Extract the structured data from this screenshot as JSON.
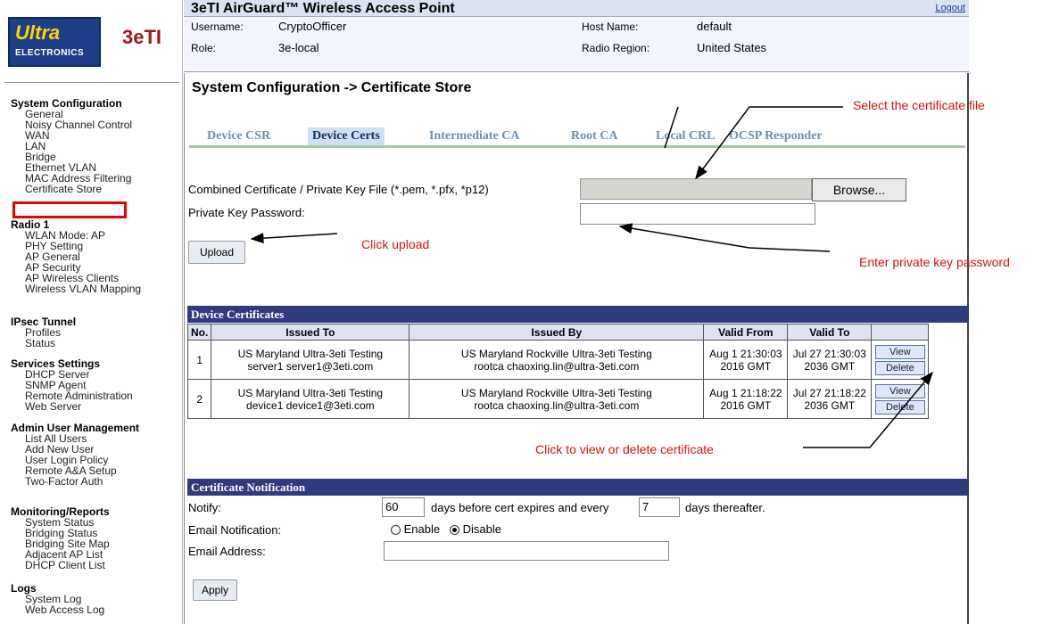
{
  "brand": {
    "ultra_line1": "Ultra",
    "ultra_line2": "ELECTRONICS",
    "company": "3eTI"
  },
  "header": {
    "title": "3eTI AirGuard™ Wireless Access Point",
    "logout": "Logout",
    "username_label": "Username:",
    "username": "CryptoOfficer",
    "role_label": "Role:",
    "role": "3e-local",
    "hostname_label": "Host Name:",
    "hostname": "default",
    "region_label": "Radio Region:",
    "region": "United States"
  },
  "sidebar": {
    "sections": [
      {
        "title": "System Configuration",
        "items": [
          "General",
          "Noisy Channel Control",
          "WAN",
          "LAN",
          "Bridge",
          "Ethernet VLAN",
          "MAC Address Filtering",
          "Certificate Store"
        ]
      },
      {
        "title": "Radio 1",
        "items": [
          "WLAN Mode: AP",
          "PHY Setting",
          "AP General",
          "AP Security",
          "AP Wireless Clients",
          "Wireless VLAN Mapping"
        ]
      },
      {
        "title": "IPsec Tunnel",
        "items": [
          "Profiles",
          "Status"
        ]
      },
      {
        "title": "Services Settings",
        "items": [
          "DHCP Server",
          "SNMP Agent",
          "Remote Administration",
          "Web Server"
        ]
      },
      {
        "title": "Admin User Management",
        "items": [
          "List All Users",
          "Add New User",
          "User Login Policy",
          "Remote A&A Setup",
          "Two-Factor Auth"
        ]
      },
      {
        "title": "Monitoring/Reports",
        "items": [
          "System Status",
          "Bridging Status",
          "Bridging Site Map",
          "Adjacent AP List",
          "DHCP Client List"
        ]
      },
      {
        "title": "Logs",
        "items": [
          "System Log",
          "Web Access Log"
        ]
      }
    ]
  },
  "page": {
    "title": "System Configuration -> Certificate Store"
  },
  "tabs": [
    "Device CSR",
    "Device Certs",
    "Intermediate CA",
    "Root CA",
    "Local CRL",
    "OCSP Responder"
  ],
  "upload_form": {
    "file_label": "Combined Certificate / Private Key File (*.pem, *.pfx, *p12)",
    "browse": "Browse...",
    "password_label": "Private Key Password:",
    "upload": "Upload"
  },
  "certificates": {
    "header": "Device Certificates",
    "columns": [
      "No.",
      "Issued To",
      "Issued By",
      "Valid From",
      "Valid To"
    ],
    "rows": [
      {
        "no": "1",
        "to1": "US Maryland Ultra-3eti Testing",
        "to2": "server1 server1@3eti.com",
        "by1": "US Maryland Rockville Ultra-3eti Testing",
        "by2": "rootca chaoxing.lin@ultra-3eti.com",
        "from1": "Aug 1 21:30:03",
        "from2": "2016 GMT",
        "until1": "Jul 27 21:30:03",
        "until2": "2036 GMT"
      },
      {
        "no": "2",
        "to1": "US Maryland Ultra-3eti Testing",
        "to2": "device1 device1@3eti.com",
        "by1": "US Maryland Rockville Ultra-3eti Testing",
        "by2": "rootca chaoxing.lin@ultra-3eti.com",
        "from1": "Aug 1 21:18:22",
        "from2": "2016 GMT",
        "until1": "Jul 27 21:18:22",
        "until2": "2036 GMT"
      }
    ],
    "view": "View",
    "delete": "Delete"
  },
  "notification": {
    "header": "Certificate Notification",
    "notify_label": "Notify:",
    "notify_days": "60",
    "before_text": "days before cert expires and every",
    "every_days": "7",
    "after_text": "days thereafter.",
    "email_notif_label": "Email Notification:",
    "enable": "Enable",
    "disable": "Disable",
    "selected": "Disable",
    "email_label": "Email Address:",
    "email_value": "",
    "apply": "Apply"
  },
  "annotations": {
    "select_file": "Select the certificate file",
    "click_upload": "Click upload",
    "enter_password": "Enter private key password",
    "view_delete": "Click to view or delete certificate"
  },
  "colors": {
    "annotation": "#e01010",
    "section_header": "#2f3a80",
    "highlight_box": "#ee0000"
  }
}
